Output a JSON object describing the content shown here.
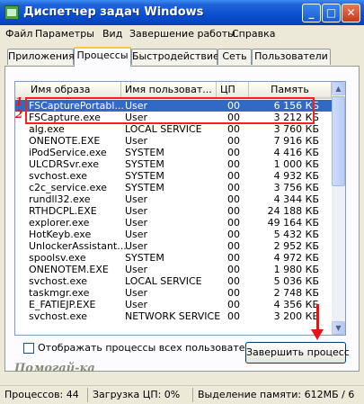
{
  "window": {
    "title": "Диспетчер задач Windows"
  },
  "menu": [
    "Файл",
    "Параметры",
    "Вид",
    "Завершение работы",
    "Справка"
  ],
  "tabs": [
    "Приложения",
    "Процессы",
    "Быстродействие",
    "Сеть",
    "Пользователи"
  ],
  "active_tab": "Процессы",
  "columns": {
    "name": "Имя образа",
    "user": "Имя пользоват...",
    "cpu": "ЦП",
    "mem": "Память"
  },
  "processes": [
    {
      "name": "FSCapturePortabl...",
      "user": "User",
      "cpu": "00",
      "mem": "6 156 КБ",
      "selected": true
    },
    {
      "name": "FSCapture.exe",
      "user": "User",
      "cpu": "00",
      "mem": "3 212 КБ"
    },
    {
      "name": "alg.exe",
      "user": "LOCAL SERVICE",
      "cpu": "00",
      "mem": "3 760 КБ"
    },
    {
      "name": "ONENOTE.EXE",
      "user": "User",
      "cpu": "00",
      "mem": "7 916 КБ"
    },
    {
      "name": "iPodService.exe",
      "user": "SYSTEM",
      "cpu": "00",
      "mem": "4 416 КБ"
    },
    {
      "name": "ULCDRSvr.exe",
      "user": "SYSTEM",
      "cpu": "00",
      "mem": "1 000 КБ"
    },
    {
      "name": "svchost.exe",
      "user": "SYSTEM",
      "cpu": "00",
      "mem": "4 932 КБ"
    },
    {
      "name": "c2c_service.exe",
      "user": "SYSTEM",
      "cpu": "00",
      "mem": "3 756 КБ"
    },
    {
      "name": "rundll32.exe",
      "user": "User",
      "cpu": "00",
      "mem": "4 344 КБ"
    },
    {
      "name": "RTHDCPL.EXE",
      "user": "User",
      "cpu": "00",
      "mem": "24 188 КБ"
    },
    {
      "name": "explorer.exe",
      "user": "User",
      "cpu": "00",
      "mem": "49 164 КБ"
    },
    {
      "name": "HotKeyb.exe",
      "user": "User",
      "cpu": "00",
      "mem": "5 432 КБ"
    },
    {
      "name": "UnlockerAssistant...",
      "user": "User",
      "cpu": "00",
      "mem": "2 952 КБ"
    },
    {
      "name": "spoolsv.exe",
      "user": "SYSTEM",
      "cpu": "00",
      "mem": "4 972 КБ"
    },
    {
      "name": "ONENOTEM.EXE",
      "user": "User",
      "cpu": "00",
      "mem": "1 980 КБ"
    },
    {
      "name": "svchost.exe",
      "user": "LOCAL SERVICE",
      "cpu": "00",
      "mem": "5 036 КБ"
    },
    {
      "name": "taskmgr.exe",
      "user": "User",
      "cpu": "00",
      "mem": "2 748 КБ"
    },
    {
      "name": "E_FATIEJP.EXE",
      "user": "User",
      "cpu": "00",
      "mem": "4 356 КБ"
    },
    {
      "name": "svchost.exe",
      "user": "NETWORK SERVICE",
      "cpu": "00",
      "mem": "3 200 КБ"
    }
  ],
  "annotations": {
    "n1": "1",
    "n2": "2",
    "watermark": "Помогай-ка"
  },
  "show_all_label": "Отображать процессы всех пользователей",
  "end_process_label": "Завершить процесс",
  "status": {
    "processes": "Процессов: 44",
    "cpu": "Загрузка ЦП: 0%",
    "mem": "Выделение памяти: 612МБ / 6"
  },
  "colors": {
    "selection": "#316ac5",
    "annotation": "#e81414",
    "titlebar": "#0a4fd0"
  }
}
